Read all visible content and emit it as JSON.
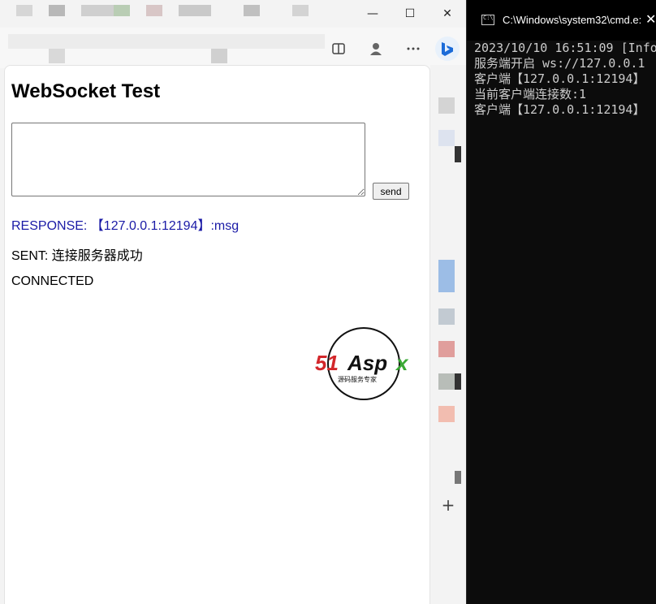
{
  "browser": {
    "window_controls": {
      "minimize": "—",
      "maximize": "☐",
      "close": "✕"
    },
    "toolbar_icons": [
      "split-screen-icon",
      "profile-icon",
      "more-icon",
      "bing-icon"
    ],
    "sidebar": {
      "add_label": "+"
    }
  },
  "page": {
    "title": "WebSocket Test",
    "message_input_value": "",
    "send_label": "send",
    "response_line": "RESPONSE: 【127.0.0.1:12194】:msg",
    "sent_line": "SENT: 连接服务器成功",
    "status_line": "CONNECTED",
    "watermark": {
      "brand": "51Aspx",
      "tagline": "源码服务专家",
      "red": "#d3272b",
      "green": "#3aa935"
    }
  },
  "console": {
    "caption": "C:\\Windows\\system32\\cmd.e:",
    "close_label": "✕",
    "lines": [
      "2023/10/10 16:51:09 [Info",
      "服务端开启 ws://127.0.0.1",
      "客户端【127.0.0.1:12194】",
      "当前客户端连接数:1",
      "客户端【127.0.0.1:12194】"
    ]
  },
  "colors": {
    "response_text": "#1a1aa6",
    "console_bg": "#0c0c0c",
    "console_text": "#cccccc"
  }
}
